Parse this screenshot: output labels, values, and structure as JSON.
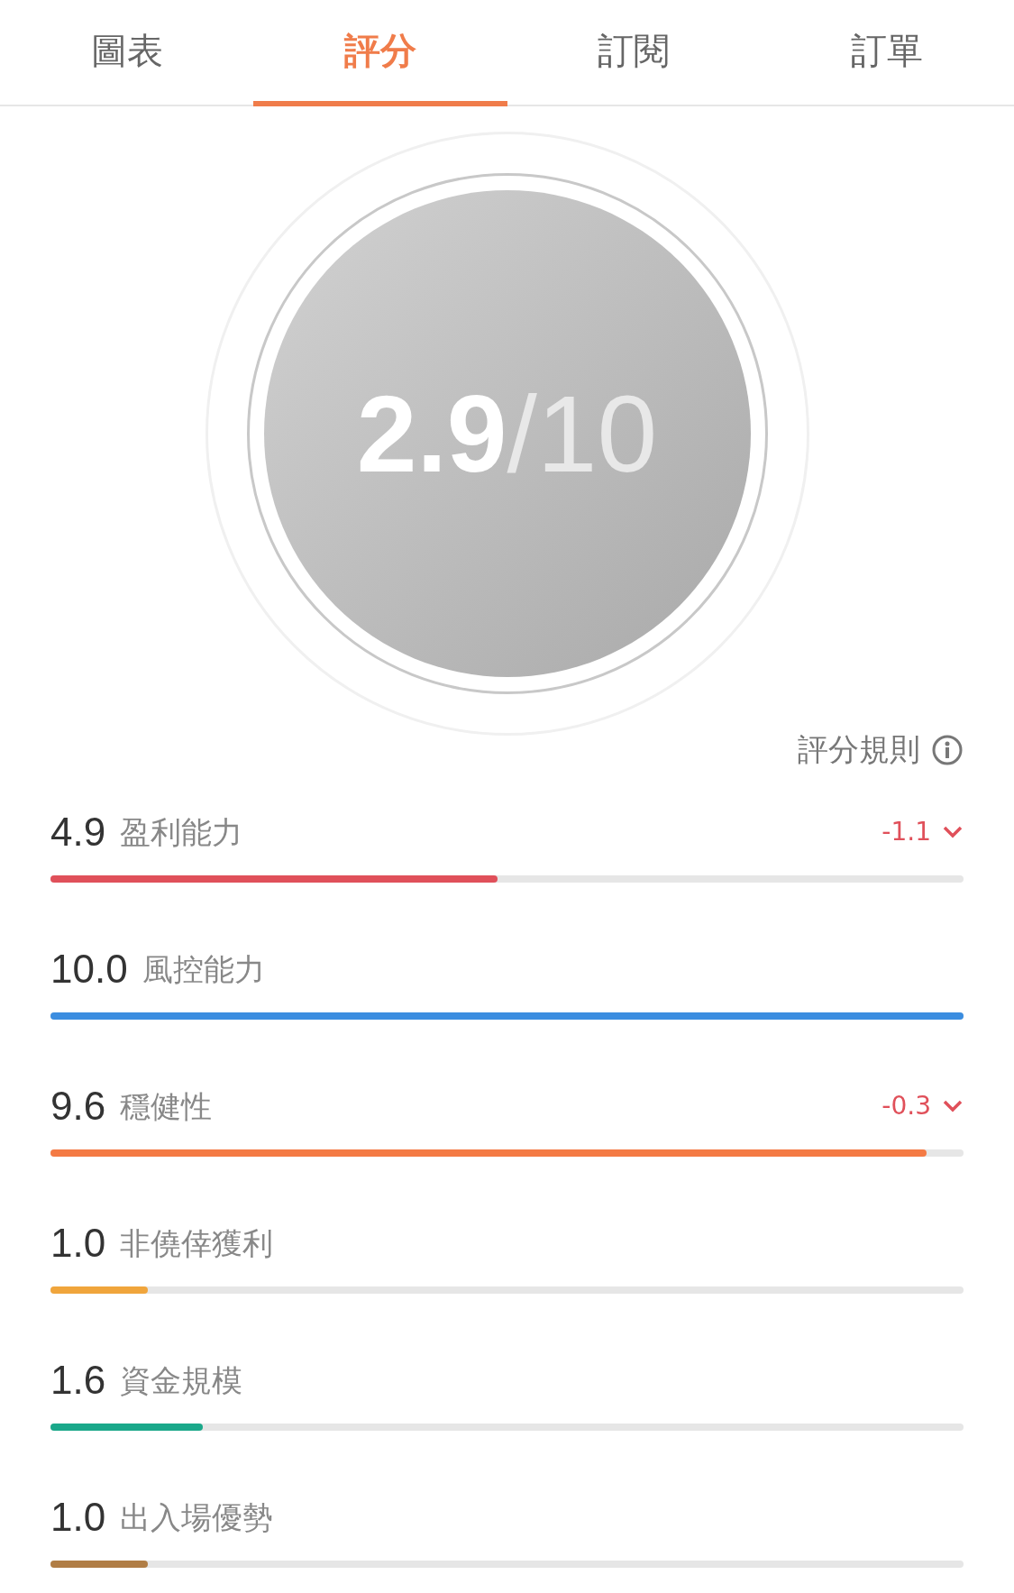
{
  "tabs": [
    {
      "label": "圖表",
      "selected": false
    },
    {
      "label": "評分",
      "selected": true
    },
    {
      "label": "訂閱",
      "selected": false
    },
    {
      "label": "訂單",
      "selected": false
    }
  ],
  "score": {
    "value": "2.9",
    "out_of": "/10"
  },
  "rules_link": "評分規則",
  "metrics": [
    {
      "value": "4.9",
      "label": "盈利能力",
      "level": 0.49,
      "color": "#e0505a",
      "delta": "-1.1"
    },
    {
      "value": "10.0",
      "label": "風控能力",
      "level": 1.0,
      "color": "#3b8de0"
    },
    {
      "value": "9.6",
      "label": "穩健性",
      "level": 0.96,
      "color": "#f47a44",
      "delta": "-0.3"
    },
    {
      "value": "1.0",
      "label": "非僥倖獲利",
      "level": 0.107,
      "color": "#f0a53c"
    },
    {
      "value": "1.6",
      "label": "資金規模",
      "level": 0.167,
      "color": "#1aa88a"
    },
    {
      "value": "1.0",
      "label": "出入場優勢",
      "level": 0.107,
      "color": "#b07d45"
    }
  ]
}
